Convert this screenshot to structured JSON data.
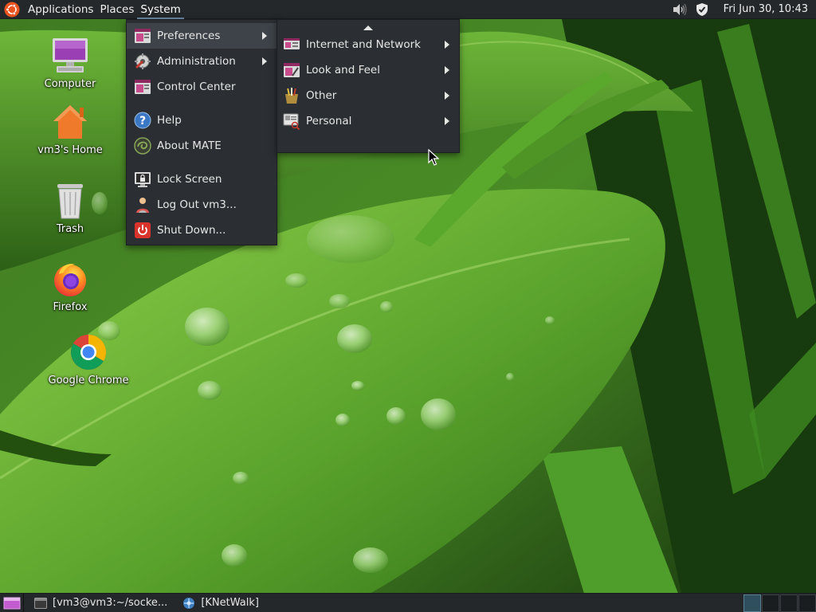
{
  "top_panel": {
    "menus": [
      "Applications",
      "Places",
      "System"
    ],
    "active_menu": "System",
    "clock": "Fri Jun 30, 10:43",
    "tray": [
      {
        "icon": "volume-icon"
      },
      {
        "icon": "shield-icon"
      }
    ]
  },
  "desktop_icons": [
    {
      "label": "Computer",
      "icon": "computer-icon"
    },
    {
      "label": "vm3's Home",
      "icon": "home-folder-icon"
    },
    {
      "label": "Trash",
      "icon": "trash-icon"
    },
    {
      "label": "Firefox",
      "icon": "firefox-icon"
    },
    {
      "label": "Google Chrome",
      "icon": "chrome-icon"
    }
  ],
  "system_menu": {
    "items": [
      {
        "label": "Preferences",
        "icon": "preferences-icon",
        "submenu": true
      },
      {
        "label": "Administration",
        "icon": "administration-icon",
        "submenu": true
      },
      {
        "label": "Control Center",
        "icon": "control-center-icon",
        "submenu": false
      },
      {
        "label": "Help",
        "icon": "help-icon",
        "submenu": false
      },
      {
        "label": "About MATE",
        "icon": "mate-logo-icon",
        "submenu": false
      },
      {
        "label": "Lock Screen",
        "icon": "lock-screen-icon",
        "submenu": false
      },
      {
        "label": "Log Out vm3...",
        "icon": "logout-icon",
        "submenu": false
      },
      {
        "label": "Shut Down...",
        "icon": "power-icon",
        "submenu": false
      }
    ]
  },
  "preferences_submenu": {
    "items": [
      {
        "label": "Internet and Network",
        "icon": "network-prefs-icon",
        "submenu": true
      },
      {
        "label": "Look and Feel",
        "icon": "appearance-icon",
        "submenu": true
      },
      {
        "label": "Other",
        "icon": "other-prefs-icon",
        "submenu": true
      },
      {
        "label": "Personal",
        "icon": "personal-prefs-icon",
        "submenu": true
      }
    ]
  },
  "bottom_panel": {
    "tasks": [
      {
        "label": "[vm3@vm3:~/socke...",
        "icon": "terminal-icon"
      },
      {
        "label": "[KNetWalk]",
        "icon": "knetwalk-icon"
      }
    ],
    "workspaces": 4,
    "active_workspace": 1
  },
  "colors": {
    "panel_bg": "#24282b",
    "menu_bg": "#2b2f33",
    "menu_hover": "#3d4348",
    "accent": "#6a8aa6"
  }
}
